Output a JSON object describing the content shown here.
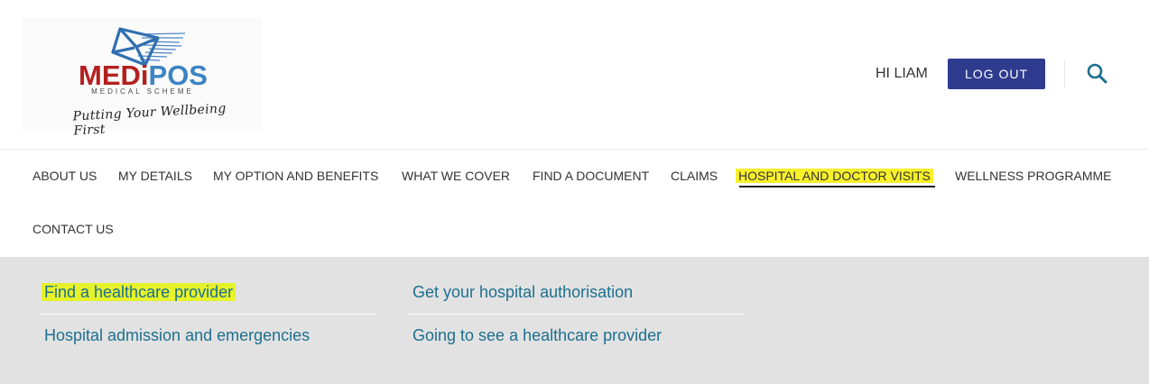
{
  "logo": {
    "brand_red": "MED",
    "brand_i": "i",
    "brand_blue": "POS",
    "subtitle": "MEDICAL SCHEME",
    "tagline": "Putting Your Wellbeing First"
  },
  "header": {
    "greeting": "HI LIAM",
    "logout_label": "LOG OUT"
  },
  "nav": {
    "items": [
      {
        "label": "ABOUT US"
      },
      {
        "label": "MY DETAILS"
      },
      {
        "label": "MY OPTION AND BENEFITS"
      },
      {
        "label": "WHAT WE COVER"
      },
      {
        "label": "FIND A DOCUMENT"
      },
      {
        "label": "CLAIMS"
      },
      {
        "label": "HOSPITAL AND DOCTOR VISITS"
      },
      {
        "label": "WELLNESS PROGRAMME"
      },
      {
        "label": "CONTACT US"
      }
    ]
  },
  "submenu": {
    "col1": [
      {
        "label": "Find a healthcare provider"
      },
      {
        "label": "Hospital admission and emergencies"
      }
    ],
    "col2": [
      {
        "label": "Get your hospital authorisation"
      },
      {
        "label": "Going to see a healthcare provider"
      }
    ]
  },
  "colors": {
    "brand_red": "#b3201f",
    "brand_blue": "#3c84c2",
    "logout_bg": "#2e3b8f",
    "link": "#1d6f8f",
    "highlight": "#f8f02a",
    "menu_bg": "#e2e2e2"
  },
  "icons": {
    "search": "search-icon",
    "logo_envelope": "envelope-icon"
  }
}
